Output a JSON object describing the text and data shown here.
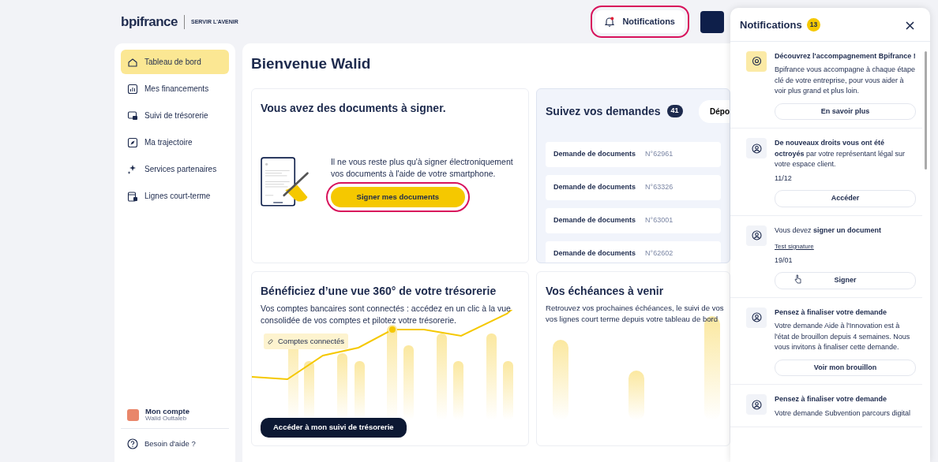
{
  "header": {
    "logo": "bpifrance",
    "tagline": "SERVIR L'AVENIR",
    "notifications_button": {
      "label": "Notifications",
      "highlighted": true
    }
  },
  "sidebar": {
    "items": [
      {
        "label": "Tableau de bord",
        "selected": true
      },
      {
        "label": "Mes financements",
        "selected": false
      },
      {
        "label": "Suivi de trésorerie",
        "selected": false
      },
      {
        "label": "Ma trajectoire",
        "selected": false
      },
      {
        "label": "Services partenaires",
        "selected": false
      },
      {
        "label": "Lignes court-terme",
        "selected": false
      }
    ],
    "account": {
      "title": "Mon compte",
      "name": "Walid Outtaleb"
    },
    "help": "Besoin d'aide ?"
  },
  "main": {
    "title": "Bienvenue Walid",
    "sign_card": {
      "title": "Vous avez des documents à signer.",
      "text": "Il ne vous reste plus qu'à signer électroniquement vos documents à l'aide de votre smartphone.",
      "button": {
        "label": "Signer mes documents",
        "highlighted": true
      }
    },
    "requests_card": {
      "title": "Suivez vos demandes",
      "count": "41",
      "button": "Dépo",
      "rows": [
        {
          "label": "Demande de documents",
          "number": "N°62961"
        },
        {
          "label": "Demande de documents",
          "number": "N°63326"
        },
        {
          "label": "Demande de documents",
          "number": "N°63001"
        },
        {
          "label": "Demande de documents",
          "number": "N°62602"
        }
      ]
    },
    "treasury_card": {
      "title": "Bénéficiez d’une vue 360° de votre trésorerie",
      "text": "Vos comptes bancaires sont connectés : accédez en un clic à la vue consolidée de vos comptes et pilotez votre trésorerie.",
      "tag": "Comptes connectés",
      "button": "Accéder à mon suivi de trésorerie"
    },
    "due_card": {
      "title": "Vos échéances à venir",
      "lines": [
        "Retrouvez vos prochaines échéances, le suivi de vos",
        "vos lignes court terme depuis votre tableau de bord"
      ]
    }
  },
  "notifications": {
    "title": "Notifications",
    "count": "13",
    "items": [
      {
        "kind": "promo",
        "title": "Découvrez l'accompagnement Bpifrance !",
        "body": "Bpifrance vous accompagne à chaque étape clé de votre entreprise, pour vous aider à voir plus grand et plus loin.",
        "button": "En savoir plus"
      },
      {
        "kind": "account",
        "title": "**De nouveaux droits vous ont été octroyés** par votre représentant légal sur votre espace client.",
        "date": "11/12",
        "button": "Accéder"
      },
      {
        "kind": "account",
        "title": "Vous devez **signer un document**",
        "link": "Test signature",
        "date": "19/01",
        "button": "Signer"
      },
      {
        "kind": "account",
        "title": "**Pensez à finaliser votre demande**",
        "body": "Votre demande Aide à l'Innovation est à l'état de brouillon depuis 4 semaines. Nous vous invitons à finaliser cette demande.",
        "button": "Voir mon brouillon"
      },
      {
        "kind": "account",
        "title": "**Pensez à finaliser votre demande**",
        "body": "Votre demande Subvention parcours digital"
      }
    ]
  }
}
